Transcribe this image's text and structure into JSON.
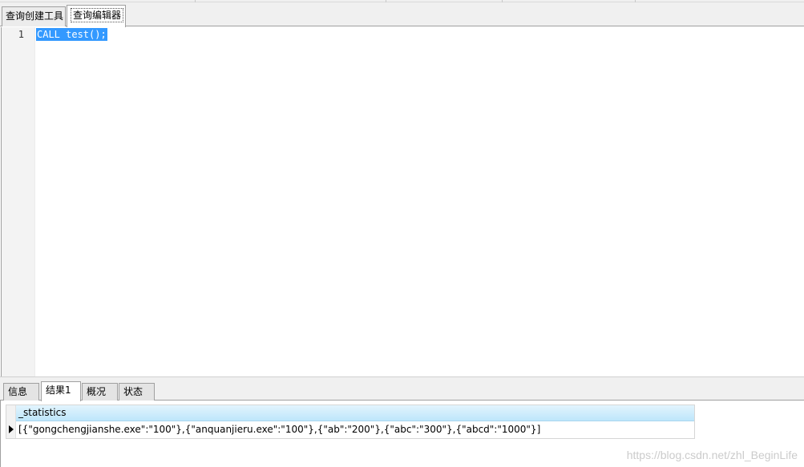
{
  "query_tabs": {
    "builder_label": "查询创建工具",
    "editor_label": "查询编辑器"
  },
  "editor": {
    "line_number": "1",
    "code": "CALL test();"
  },
  "result_tabs": {
    "info_label": "信息",
    "result1_label": "结果1",
    "overview_label": "概况",
    "status_label": "状态"
  },
  "result_grid": {
    "column_header": "_statistics",
    "row_value": "[{\"gongchengjianshe.exe\":\"100\"},{\"anquanjieru.exe\":\"100\"},{\"ab\":\"200\"},{\"abc\":\"300\"},{\"abcd\":\"1000\"}]"
  },
  "watermark": "https://blog.csdn.net/zhl_BeginLife"
}
